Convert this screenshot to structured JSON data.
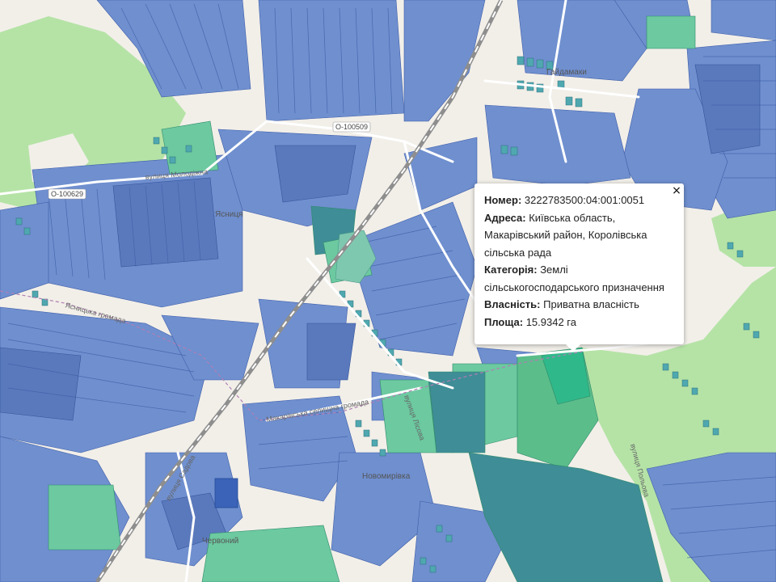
{
  "map": {
    "place_labels": [
      {
        "id": "gaidamaky",
        "text": "Гайдамаки"
      },
      {
        "id": "yasnitska",
        "text": "Ясниця"
      },
      {
        "id": "novomyrivka",
        "text": "Новомирівка"
      },
      {
        "id": "chervonyi",
        "text": "Червоний"
      }
    ],
    "road_shields": [
      {
        "id": "o100509",
        "text": "О-100509"
      },
      {
        "id": "o100629",
        "text": "О-100629"
      }
    ],
    "boundary_labels": [
      {
        "id": "hromada-west",
        "text": "Ясницька громада"
      },
      {
        "id": "hromada-south",
        "text": "Макарівська селищна громада"
      }
    ],
    "street_labels": [
      {
        "id": "street-1",
        "text": "вулиця Молодіжна"
      },
      {
        "id": "street-2",
        "text": "вулиця Лісова"
      },
      {
        "id": "street-3",
        "text": "вулиця Садова"
      },
      {
        "id": "street-4",
        "text": "вулиця Польова"
      }
    ],
    "colors": {
      "background": "#f2efe9",
      "parcel_agri": "#6f8fcf",
      "parcel_agri_dark": "#5a79bc",
      "parcel_green": "#63c48f",
      "parcel_teal": "#3f8d96",
      "forest": "#b5e3a6",
      "railway": "#9a9a9a",
      "water": "#bfe7ee"
    }
  },
  "popup": {
    "number_label": "Номер:",
    "number_value": "3222783500:04:001:0051",
    "address_label": "Адреса:",
    "address_value": "Київська область, Макарівський район, Королівська сільська рада",
    "category_label": "Категорія:",
    "category_value": "Землі сільськогосподарського призначення",
    "ownership_label": "Власність:",
    "ownership_value": "Приватна власність",
    "area_label": "Площа:",
    "area_value": "15.9342 га",
    "close_glyph": "×"
  }
}
